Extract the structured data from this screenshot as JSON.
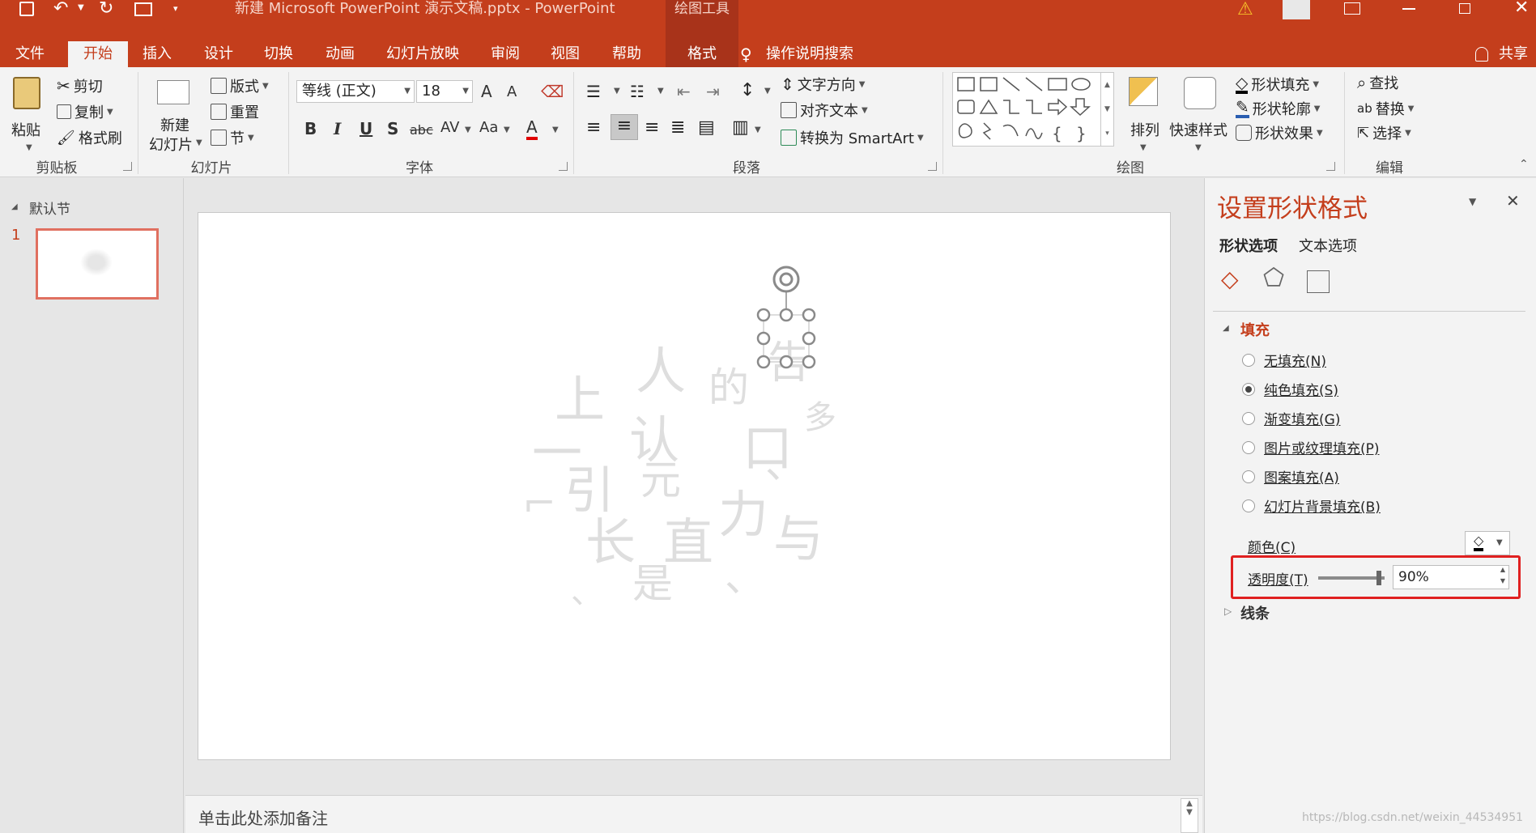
{
  "window": {
    "title": "新建 Microsoft PowerPoint 演示文稿.pptx  -  PowerPoint",
    "context_tab_group": "绘图工具"
  },
  "tabs": [
    {
      "label": "文件"
    },
    {
      "label": "开始",
      "active": true
    },
    {
      "label": "插入"
    },
    {
      "label": "设计"
    },
    {
      "label": "切换"
    },
    {
      "label": "动画"
    },
    {
      "label": "幻灯片放映"
    },
    {
      "label": "审阅"
    },
    {
      "label": "视图"
    },
    {
      "label": "帮助"
    },
    {
      "label": "格式"
    }
  ],
  "tell_me": "操作说明搜索",
  "share": "共享",
  "ribbon": {
    "clipboard": {
      "label": "剪贴板",
      "paste": "粘贴",
      "cut": "剪切",
      "copy": "复制",
      "format_painter": "格式刷"
    },
    "slides": {
      "label": "幻灯片",
      "new_slide_1": "新建",
      "new_slide_2": "幻灯片",
      "layout": "版式",
      "reset": "重置",
      "section": "节"
    },
    "font": {
      "label": "字体",
      "font_name": "等线 (正文)",
      "font_size": "18",
      "bold": "B",
      "italic": "I",
      "underline": "U",
      "shadow": "S",
      "strike": "abc",
      "spacing": "AV",
      "case": "Aa",
      "color": "A",
      "grow": "A",
      "shrink": "A"
    },
    "paragraph": {
      "label": "段落",
      "text_direction": "文字方向",
      "align_text": "对齐文本",
      "smartart": "转换为 SmartArt"
    },
    "drawing": {
      "label": "绘图",
      "arrange": "排列",
      "quick_styles": "快速样式",
      "shape_fill": "形状填充",
      "shape_outline": "形状轮廓",
      "shape_effects": "形状效果"
    },
    "editing": {
      "label": "编辑",
      "find": "查找",
      "replace": "替换",
      "select": "选择"
    }
  },
  "slides_panel": {
    "section": "默认节",
    "slide_number": "1"
  },
  "slide_chars": [
    "人",
    "上",
    "的",
    "告",
    "一",
    "认",
    "口",
    "引",
    "多",
    "长",
    "直",
    "力",
    "元",
    "与",
    "是"
  ],
  "notes_placeholder": "单击此处添加备注",
  "format_pane": {
    "title": "设置形状格式",
    "tab_shape": "形状选项",
    "tab_text": "文本选项",
    "fill_section": "填充",
    "fill_options": [
      {
        "label": "无填充(N)",
        "selected": false
      },
      {
        "label": "纯色填充(S)",
        "selected": true
      },
      {
        "label": "渐变填充(G)",
        "selected": false
      },
      {
        "label": "图片或纹理填充(P)",
        "selected": false
      },
      {
        "label": "图案填充(A)",
        "selected": false
      },
      {
        "label": "幻灯片背景填充(B)",
        "selected": false
      }
    ],
    "color_label": "颜色(C)",
    "transparency_label": "透明度(T)",
    "transparency_value": "90%",
    "line_section": "线条"
  },
  "watermark": "https://blog.csdn.net/weixin_44534951",
  "colors": {
    "accent": "#c43e1c",
    "highlight_box": "#e02020"
  }
}
